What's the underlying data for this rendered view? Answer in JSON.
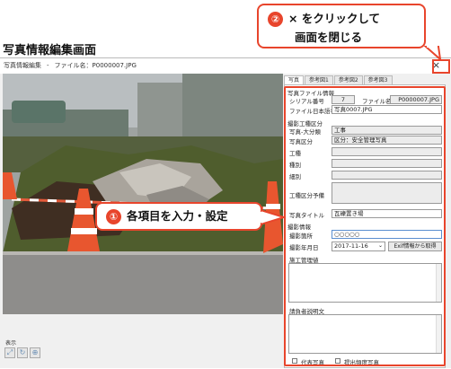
{
  "page_heading": "写真情報編集画面",
  "window": {
    "title": "写真情報編集",
    "file_label": "ファイル名：P0000007.JPG",
    "close_glyph": "×"
  },
  "tabs": [
    "写真",
    "参考図1",
    "参考図2",
    "参考図3"
  ],
  "form": {
    "section_file": "写真ファイル情報",
    "serial_label": "シリアル番号",
    "serial_value": "7",
    "filename_label": "ファイル名",
    "filename_value": "P0000007.JPG",
    "japanese_name_label": "ファイル日本語名",
    "japanese_name_value": "写真0007.JPG",
    "section_work": "撮影工種区分",
    "major_label": "写真-大分類",
    "major_value": "工事",
    "category_label": "写真区分",
    "category_value": "区分：安全管理写真",
    "kouhei_label": "工種",
    "shubetsu_label": "種別",
    "saibetsu_label": "細別",
    "sub_label": "工種区分予備",
    "title_label": "写真タイトル",
    "title_value": "瓦礫置き場",
    "section_shoot": "撮影情報",
    "location_label": "撮影箇所",
    "location_value": "○○○○○",
    "date_label": "撮影年月日",
    "date_value": "2017-11-16",
    "exif_button": "Exif情報から取得",
    "construction_label": "施工管理値",
    "explanation_label": "請負者説明文",
    "representative_label": "代表写真",
    "priority_label": "提出頻度写真"
  },
  "display": {
    "label": "表示"
  },
  "annotations": {
    "callout1_num": "①",
    "callout1_text": "各項目を入力・設定",
    "callout2_num": "②",
    "callout2_line1": "× をクリックして",
    "callout2_line2": "画面を閉じる"
  },
  "colors": {
    "accent": "#e8452c"
  }
}
